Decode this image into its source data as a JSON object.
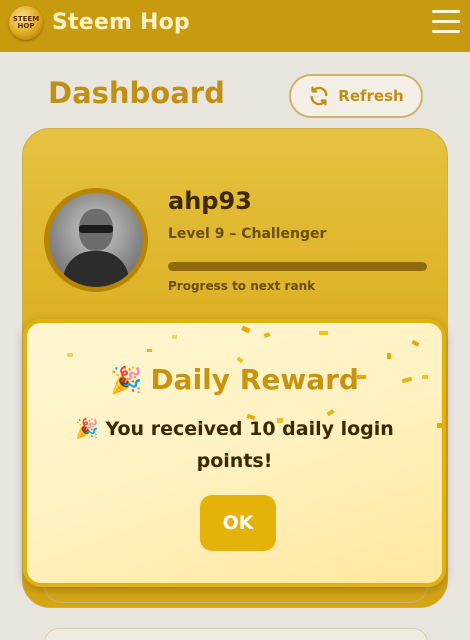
{
  "app": {
    "logo_text": "STEEM HOP",
    "title": "Steem Hop"
  },
  "header": {
    "title": "Dashboard",
    "refresh_label": "Refresh"
  },
  "profile": {
    "username": "ahp93",
    "level": "Level 9 – Challenger",
    "progress_label": "Progress to next rank",
    "progress_fraction": 0.0
  },
  "modal": {
    "title": "Daily Reward",
    "title_icon": "party-popper-icon",
    "message_icon": "🎉",
    "message": "You received 10 daily login points!",
    "ok_label": "OK"
  },
  "colors": {
    "brand": "#c89a10",
    "accent": "#e5b209",
    "title_gold": "#c08f14",
    "dark_text": "#3d2800"
  }
}
